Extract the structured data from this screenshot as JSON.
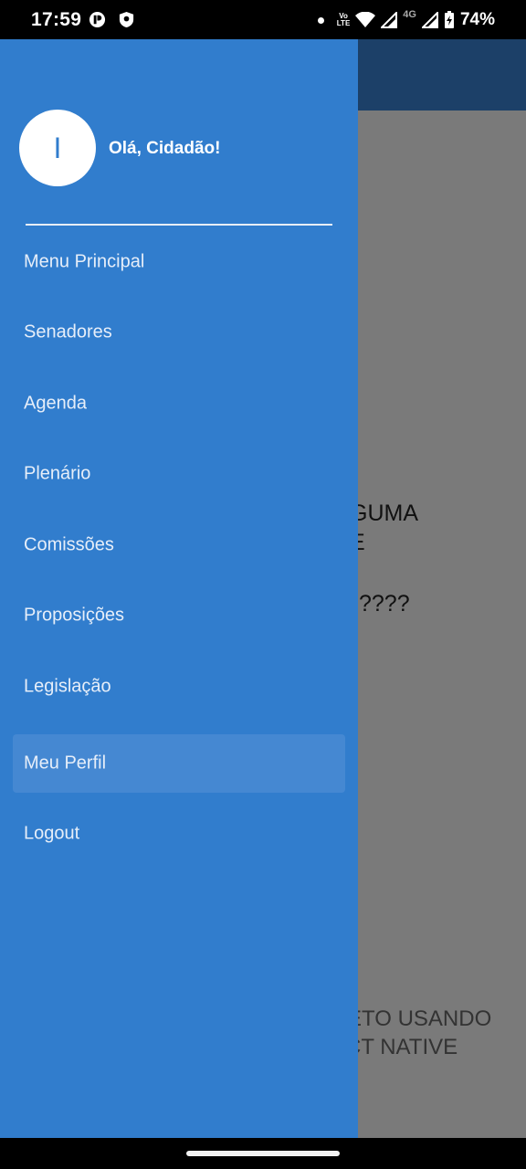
{
  "status_bar": {
    "time": "17:59",
    "lte_top": "Vo",
    "lte_bottom": "LTE",
    "network": "4G",
    "battery": "74%"
  },
  "background_app": {
    "line1": "GUMA",
    "line2": "E",
    "line3": "????",
    "footer_line1": "ETO USANDO",
    "footer_line2": "CT NATIVE"
  },
  "drawer": {
    "avatar_letter": "I",
    "greeting": "Olá, Cidadão!",
    "items": [
      {
        "label": "Menu Principal"
      },
      {
        "label": "Senadores"
      },
      {
        "label": "Agenda"
      },
      {
        "label": "Plenário"
      },
      {
        "label": "Comissões"
      },
      {
        "label": "Proposições"
      },
      {
        "label": "Legislação"
      },
      {
        "label": "Meu Perfil",
        "active": true
      },
      {
        "label": "Logout"
      }
    ],
    "colors": {
      "background": "#317dcd",
      "active_item": "#4588d2",
      "header": "#1c4068"
    }
  }
}
